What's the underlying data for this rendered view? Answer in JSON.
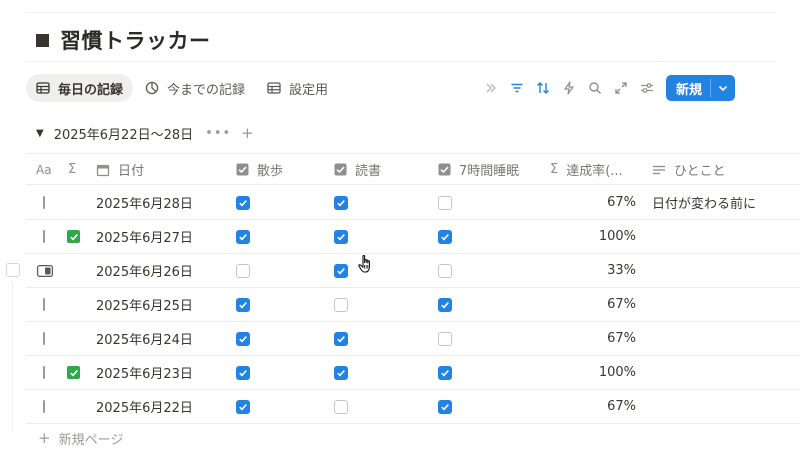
{
  "page": {
    "title": "習慣トラッカー",
    "title_icon": "square-icon"
  },
  "views": [
    {
      "label": "毎日の記録",
      "icon": "table-icon",
      "active": true
    },
    {
      "label": "今までの記録",
      "icon": "chart-pie-icon",
      "active": false
    },
    {
      "label": "設定用",
      "icon": "table-icon",
      "active": false
    }
  ],
  "toolbar": {
    "icons": [
      "double-chevron-icon",
      "filter-icon",
      "sort-icon",
      "lightning-icon",
      "search-icon",
      "expand-icon",
      "settings-sliders-icon"
    ],
    "new_label": "新規"
  },
  "group": {
    "title": "2025年6月22日〜28日",
    "more": "•••",
    "add": "+"
  },
  "columns": [
    {
      "key": "name",
      "label": "",
      "icon": "text-aa-icon"
    },
    {
      "key": "sum",
      "label": "",
      "icon": "sigma-icon"
    },
    {
      "key": "date",
      "label": "日付",
      "icon": "calendar-icon"
    },
    {
      "key": "walk",
      "label": "散歩",
      "icon": "checkbox-icon"
    },
    {
      "key": "read",
      "label": "読書",
      "icon": "checkbox-icon"
    },
    {
      "key": "sleep",
      "label": "7時間睡眠",
      "icon": "checkbox-icon"
    },
    {
      "key": "rate",
      "label": "達成率(...",
      "icon": "sigma-icon"
    },
    {
      "key": "note",
      "label": "ひとこと",
      "icon": "lines-icon"
    }
  ],
  "header_icon_glyphs": {
    "aa": "Aa",
    "sigma": "Σ"
  },
  "rows": [
    {
      "date": "2025年6月28日",
      "done": false,
      "walk": true,
      "read": true,
      "sleep": false,
      "rate": "67%",
      "note": "日付が変わる前に"
    },
    {
      "date": "2025年6月27日",
      "done": true,
      "walk": true,
      "read": true,
      "sleep": true,
      "rate": "100%",
      "note": ""
    },
    {
      "date": "2025年6月26日",
      "done": false,
      "walk": false,
      "read": true,
      "sleep": false,
      "rate": "33%",
      "note": "",
      "open_icon": true
    },
    {
      "date": "2025年6月25日",
      "done": false,
      "walk": true,
      "read": false,
      "sleep": true,
      "rate": "67%",
      "note": ""
    },
    {
      "date": "2025年6月24日",
      "done": false,
      "walk": true,
      "read": true,
      "sleep": false,
      "rate": "67%",
      "note": ""
    },
    {
      "date": "2025年6月23日",
      "done": true,
      "walk": true,
      "read": true,
      "sleep": true,
      "rate": "100%",
      "note": ""
    },
    {
      "date": "2025年6月22日",
      "done": false,
      "walk": true,
      "read": false,
      "sleep": true,
      "rate": "67%",
      "note": ""
    }
  ],
  "footer": {
    "new_page_label": "新規ページ",
    "plus": "+"
  },
  "colors": {
    "accent": "#2383e2",
    "done_green": "#2ea84a",
    "text": "#37352f",
    "muted": "#9b9a97"
  }
}
